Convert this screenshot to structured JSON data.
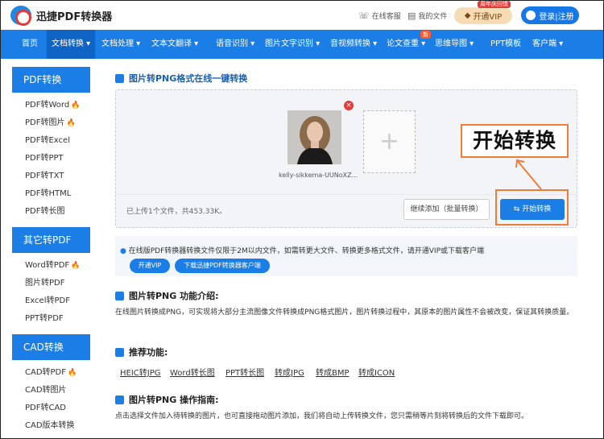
{
  "header": {
    "logo_text": "迅捷PDF转换器",
    "service_link": "在线客服",
    "docs_link": "我的文件",
    "vip_button": "开通VIP",
    "vip_badge": "周年庆回馈",
    "login_button": "登录|注册"
  },
  "nav": {
    "items": [
      {
        "label": "首页"
      },
      {
        "label": "文档转换 ▾"
      },
      {
        "label": "文档处理 ▾"
      },
      {
        "label": "文本文翻译 ▾"
      },
      {
        "label": "语音识别 ▾"
      },
      {
        "label": "图片文字识别 ▾"
      },
      {
        "label": "音视频转换 ▾"
      },
      {
        "label": "论文查重 ▾"
      },
      {
        "label": "思维导图 ▾"
      },
      {
        "label": "PPT模板"
      },
      {
        "label": "客户端 ▾"
      }
    ],
    "badge": "新"
  },
  "sidebar": {
    "groups": [
      {
        "title": "PDF转换",
        "items": [
          {
            "label": "PDF转Word",
            "hot": "🔥"
          },
          {
            "label": "PDF转图片",
            "hot": "🔥"
          },
          {
            "label": "PDF转Excel",
            "hot": ""
          },
          {
            "label": "PDF转PPT",
            "hot": ""
          },
          {
            "label": "PDF转TXT",
            "hot": ""
          },
          {
            "label": "PDF转HTML",
            "hot": ""
          },
          {
            "label": "PDF转长图",
            "hot": ""
          }
        ]
      },
      {
        "title": "其它转PDF",
        "items": [
          {
            "label": "Word转PDF",
            "hot": "🔥"
          },
          {
            "label": "图片转PDF",
            "hot": ""
          },
          {
            "label": "Excel转PDF",
            "hot": ""
          },
          {
            "label": "PPT转PDF",
            "hot": ""
          }
        ]
      },
      {
        "title": "CAD转换",
        "items": [
          {
            "label": "CAD转PDF",
            "hot": "🔥"
          },
          {
            "label": "CAD转图片",
            "hot": ""
          },
          {
            "label": "PDF转CAD",
            "hot": ""
          },
          {
            "label": "CAD版本转换",
            "hot": ""
          }
        ]
      }
    ]
  },
  "main": {
    "title": "图片转PNG格式在线一键转换",
    "file_name": "kelly-sikkema-UUNoXZ...",
    "status": "已上传1个文件，共453.33K。",
    "continue_button": "继续添加（批量转换）",
    "convert_button": "开始转换",
    "callout": "开始转换",
    "notice": "在线版PDF转换器转换文件仅限于2M以内文件，如需转更大文件、转换更多格式文件，请开通VIP或下载客户端",
    "pill_vip": "开通VIP",
    "pill_download": "下载迅捷PDF转换器客户端",
    "intro_title": "图片转PNG 功能介绍:",
    "intro_text": "在线图片转换成PNG，可实现将大部分主流图像文件转换成PNG格式图片，图片转换过程中，其原本的图片属性不会被改变，保证其转换质量。",
    "recommend_title": "推荐功能:",
    "recommend_links": [
      "HEIC转JPG",
      "Word转长图",
      "PPT转长图",
      "转成JPG",
      "转成BMP",
      "转成ICON"
    ],
    "guide_title": "图片转PNG 操作指南:",
    "guide_text": "点击选择文件加入待转换的图片，也可直接拖动图片添加，我们将自动上传转换文件，您只需稍等片刻将转换后的文件下载即可。"
  },
  "colors": {
    "primary": "#1a7ee6",
    "accent": "#f07c3a",
    "hot": "#ff6a1a"
  }
}
